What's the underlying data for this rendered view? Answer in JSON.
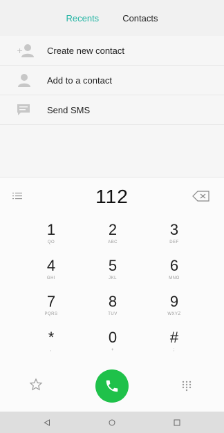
{
  "tabs": {
    "recents": "Recents",
    "contacts": "Contacts"
  },
  "list": {
    "create_new_contact": "Create new contact",
    "add_to_contact": "Add to a contact",
    "send_sms": "Send SMS"
  },
  "dialer": {
    "number": "112"
  },
  "keys": [
    {
      "digit": "1",
      "letters": "QO"
    },
    {
      "digit": "2",
      "letters": "ABC"
    },
    {
      "digit": "3",
      "letters": "DEF"
    },
    {
      "digit": "4",
      "letters": "GHI"
    },
    {
      "digit": "5",
      "letters": "JKL"
    },
    {
      "digit": "6",
      "letters": "MNO"
    },
    {
      "digit": "7",
      "letters": "PQRS"
    },
    {
      "digit": "8",
      "letters": "TUV"
    },
    {
      "digit": "9",
      "letters": "WXYZ"
    },
    {
      "digit": "*",
      "letters": ","
    },
    {
      "digit": "0",
      "letters": "+"
    },
    {
      "digit": "#",
      "letters": ";"
    }
  ],
  "colors": {
    "accent": "#24b5a4",
    "call_green": "#1fc14a"
  },
  "icons": {
    "create_contact": "person-add-icon",
    "add_contact": "person-icon",
    "sms": "message-icon",
    "menu": "menu-icon",
    "backspace": "backspace-icon",
    "favorite": "star-icon",
    "call": "phone-icon",
    "dialpad": "dialpad-icon",
    "back": "back-triangle-icon",
    "home": "home-circle-icon",
    "recents": "recents-square-icon"
  }
}
